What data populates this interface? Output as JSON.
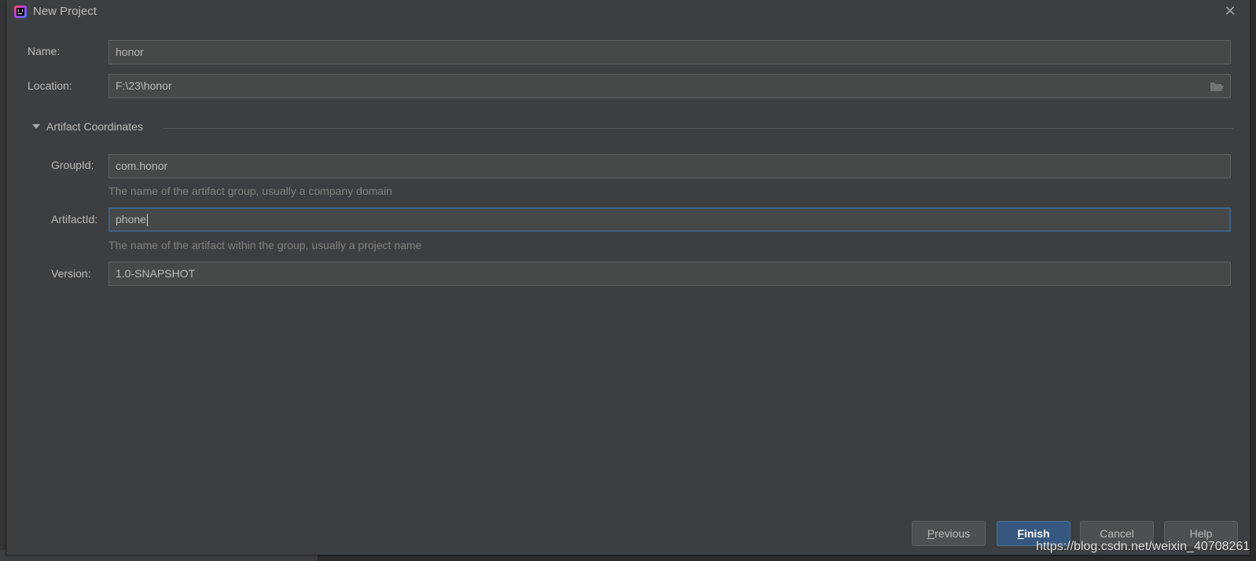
{
  "dialog": {
    "title": "New Project",
    "close_icon": "close-icon",
    "app_icon": "intellij-idea-icon"
  },
  "form": {
    "name": {
      "label": "Name:",
      "value": "honor"
    },
    "location": {
      "label": "Location:",
      "value": "F:\\23\\honor",
      "browse_icon": "folder-open-icon"
    },
    "section": {
      "title": "Artifact Coordinates",
      "expanded": true,
      "toggle_icon": "triangle-down-icon"
    },
    "group_id": {
      "label": "GroupId:",
      "value": "com.honor",
      "hint": "The name of the artifact group, usually a company domain"
    },
    "artifact_id": {
      "label": "ArtifactId:",
      "value": "phone",
      "hint": "The name of the artifact within the group, usually a project name"
    },
    "version": {
      "label": "Version:",
      "value": "1.0-SNAPSHOT"
    }
  },
  "buttons": {
    "previous": {
      "mnemonic": "P",
      "rest": "revious"
    },
    "finish": {
      "mnemonic": "F",
      "rest": "inish"
    },
    "cancel": "Cancel",
    "help": "Help"
  },
  "watermark": "https://blog.csdn.net/weixin_40708261",
  "colors": {
    "dialog_bg": "#3c3f41",
    "field_bg": "#45494a",
    "focus_border": "#3d6185",
    "primary_button": "#365880"
  }
}
